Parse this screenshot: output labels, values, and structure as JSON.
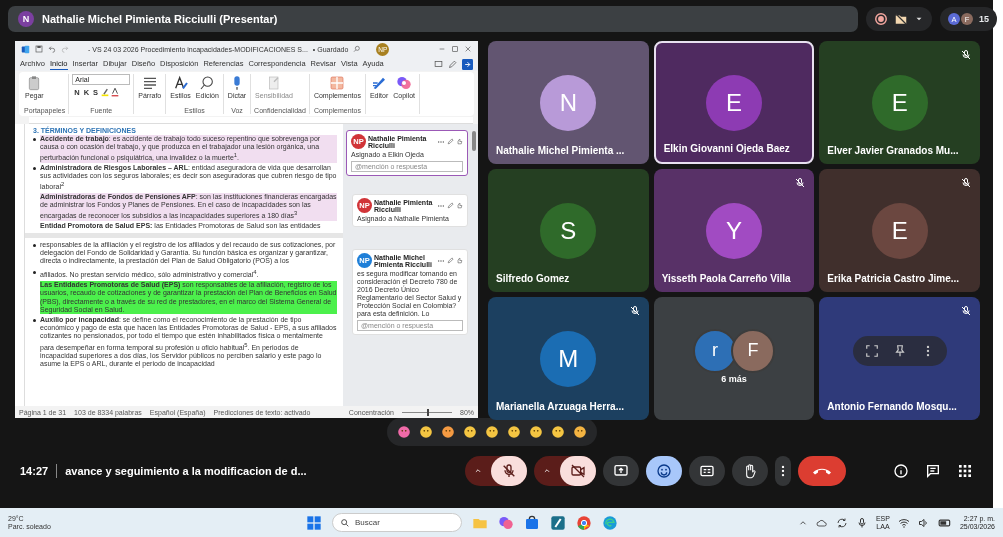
{
  "top_bar": {
    "presenter_initial": "N",
    "presenter_label": "Nathalie Michel Pimienta Ricciulli (Presentar)",
    "participant_initials": [
      "A",
      "F"
    ],
    "participant_count": "15"
  },
  "shared_document": {
    "title": "- VS 24 03 2026 Procedimiento incapacidades-MODIFICACIONES S...",
    "save_status": "• Guardado",
    "user_initials": "NP",
    "menu": [
      {
        "label": "Archivo",
        "selected": false
      },
      {
        "label": "Inicio",
        "selected": true
      },
      {
        "label": "Insertar",
        "selected": false
      },
      {
        "label": "Dibujar",
        "selected": false
      },
      {
        "label": "Diseño",
        "selected": false
      },
      {
        "label": "Disposición",
        "selected": false
      },
      {
        "label": "Referencias",
        "selected": false
      },
      {
        "label": "Correspondencia",
        "selected": false
      },
      {
        "label": "Revisar",
        "selected": false
      },
      {
        "label": "Vista",
        "selected": false
      },
      {
        "label": "Ayuda",
        "selected": false
      }
    ],
    "font_name": "Arial",
    "format_buttons": [
      "N",
      "K",
      "S"
    ],
    "ribbon_groups": [
      {
        "label": "Portapapeles",
        "buttons": [
          {
            "kind": "paste",
            "label": "Pegar",
            "disabled": false
          }
        ]
      },
      {
        "label": "Fuente",
        "kind": "font"
      },
      {
        "buttons": [
          {
            "kind": "paragraph",
            "label": "Párrafo",
            "disabled": false
          }
        ]
      },
      {
        "label": "Estilos",
        "buttons": [
          {
            "kind": "styles",
            "label": "Estilos",
            "disabled": false
          },
          {
            "kind": "search",
            "label": "Edición",
            "disabled": false
          }
        ]
      },
      {
        "label": "Voz",
        "buttons": [
          {
            "kind": "mic",
            "label": "Dictar",
            "disabled": false
          }
        ]
      },
      {
        "label": "Confidencialidad",
        "buttons": [
          {
            "kind": "sensitivity",
            "label": "Sensibilidad",
            "disabled": true
          }
        ]
      },
      {
        "label": "Complementos",
        "buttons": [
          {
            "kind": "addins",
            "label": "Complementos",
            "disabled": false
          }
        ]
      },
      {
        "buttons": [
          {
            "kind": "editor",
            "label": "Editor",
            "disabled": false
          },
          {
            "kind": "copilot",
            "label": "Copilot",
            "disabled": false
          }
        ]
      }
    ],
    "heading": "3. TÉRMINOS Y DEFINICIONES",
    "pages": [
      {
        "paragraphs": [
          {
            "kind": "bullet",
            "color": "#f1def0",
            "text": "**Accidente de trabajo**: es accidente de trabajo todo suceso repentino que sobrevenga por causa o con ocasión del trabajo, y que produzca en el trabajador una lesión orgánica, una perturbación funcional o psiquiátrica, una invalidez o la muerte$^{1}$."
          },
          {
            "kind": "bullet",
            "text": "**Administradora de Riesgos Laborales – ARL**: entidad aseguradora de vida que desarrollan sus actividades con los seguros laborales; es decir son aseguradoras que cubren riesgo de tipo laboral$^{2}$"
          },
          {
            "kind": "plain",
            "color": "#f1def0",
            "text": "**Administradoras de Fondos de Pensiones AFP**: son las instituciones financieras encargadas de administrar los Fondos y Planes de Pensiones. En el caso de incapacidades son las encargadas de reconocer los subsidios a las incapacidades superiores a 180 días$^{3}$"
          },
          {
            "kind": "plain",
            "text": "**Entidad Promotora de Salud EPS:** las Entidades Promotoras de Salud son las entidades"
          }
        ]
      },
      {
        "paragraphs": [
          {
            "kind": "bullet",
            "text": "responsables de la afiliación y el registro de los afiliados y del recaudo de sus cotizaciones, por delegación del Fondo de Solidaridad y Garantía. Su función básica es organizar y garantizar, directa o indirectamente, la prestación del Plan de Salud Obligatorio (POS) a los"
          },
          {
            "kind": "bullet",
            "text": "afiliados. No prestan servicio médico, sólo administrativo y comercial$^{4}$."
          },
          {
            "kind": "plain",
            "color": "#4cf04c",
            "text": "**Las Entidades Promotoras de Salud (EPS)** son responsables de la afiliación, registro de los usuarios, recaudo de cotizaciones y de garantizar la prestación del Plan de Beneficios en Salud (PBS), directamente o a través de su red de prestadores, en el marco del Sistema General de Seguridad Social en Salud."
          },
          {
            "kind": "bullet",
            "text": "**Auxilio por incapacidad**: se define como el reconocimiento de la prestación de tipo económico y pago de esta que hacen las Entidades Promotoras de Salud - EPS, a sus afiliados cotizantes no pensionados, por todo el tiempo que estén inhabilitados física o mentalmente para desempeñar en forma temporal su profesión u oficio habitual$^{5}$. En periodos de incapacidad superiores a dos días, los Servidor públicos no perciben salario y este pago lo asume la EPS o ARL, durante el periodo de incapacidad"
          }
        ]
      }
    ],
    "comments": [
      {
        "initials": "NP",
        "color": "#d13438",
        "author": "Nathalie Pimienta Ricciulli",
        "text": "Asignado a Elkin Ojeda",
        "reply_placeholder": "@mención o respuesta",
        "selected": true
      },
      {
        "initials": "NP",
        "color": "#d13438",
        "author": "Nathalie Pimienta Ricciulli",
        "text": "Asignado a Nathalie Pimienta",
        "selected": false
      },
      {
        "initials": "NP",
        "color": "#1e7fd8",
        "author": "Nathalie Michel Pimienta Ricciulli",
        "text": "es segura modificar tomando en consideración el Decreto 780 de 2016 Decreto Único Reglamentario del Sector Salud y Protección Social en Colombia? para esta definición. Lo",
        "reply_placeholder": "@mención o respuesta",
        "selected": false
      }
    ],
    "status_bar": {
      "page": "Página 1 de 31",
      "words": "103 de 8334 palabras",
      "language": "Español (España)",
      "predictions": "Predicciones de texto: activado",
      "focus": "Concentración",
      "zoom": "80%",
      "zoom_slider": {
        "level": 0.5
      }
    }
  },
  "tiles": [
    {
      "kind": "person",
      "initial": "N",
      "name": "Nathalie Michel Pimienta ...",
      "color": "#b89ad8",
      "speaking": false,
      "muted": false
    },
    {
      "kind": "person",
      "initial": "E",
      "name": "Elkin Giovanni Ojeda Baez",
      "color": "#8d3bb3",
      "speaking": true,
      "muted": false
    },
    {
      "kind": "person",
      "initial": "E",
      "name": "Elver Javier Granados Mu...",
      "color": "#2f6a2a",
      "speaking": false,
      "muted": true
    },
    {
      "kind": "person",
      "initial": "S",
      "name": "Silfredo Gomez",
      "color": "#2f6a2a",
      "speaking": false,
      "muted": false
    },
    {
      "kind": "person",
      "initial": "Y",
      "name": "Yisseth Paola Carreño Villa",
      "color": "#a14bc2",
      "speaking": false,
      "muted": true
    },
    {
      "kind": "person",
      "initial": "E",
      "name": "Erika Patricia Castro Jime...",
      "color": "#6b4740",
      "speaking": false,
      "muted": true
    },
    {
      "kind": "person",
      "initial": "M",
      "name": "Marianella Arzuaga Herra...",
      "color": "#1b6db3",
      "speaking": false,
      "muted": true
    },
    {
      "kind": "overflow",
      "initials": [
        "r",
        "F"
      ],
      "name": "6 más"
    },
    {
      "kind": "hovered",
      "name": "Antonio Fernando Mosqu...",
      "color": "#2f3a7a",
      "speaking": false,
      "muted": true
    }
  ],
  "meeting": {
    "time": "14:27",
    "title": "avance y seguimiento a la modificacion de d..."
  },
  "controls": [
    {
      "kind": "mic",
      "on": false
    },
    {
      "kind": "camera",
      "on": false
    },
    {
      "kind": "present"
    },
    {
      "kind": "reactions",
      "selected": true
    },
    {
      "kind": "captions",
      "on": false
    },
    {
      "kind": "hand"
    },
    {
      "kind": "more"
    },
    {
      "kind": "end"
    }
  ],
  "taskbar": {
    "temperature": "29°C",
    "weather": "Parc. soleado",
    "search_placeholder": "Buscar",
    "language": "ESP",
    "layout": "LAA",
    "time": "2:27 p. m.",
    "date": "25/03/2026"
  }
}
